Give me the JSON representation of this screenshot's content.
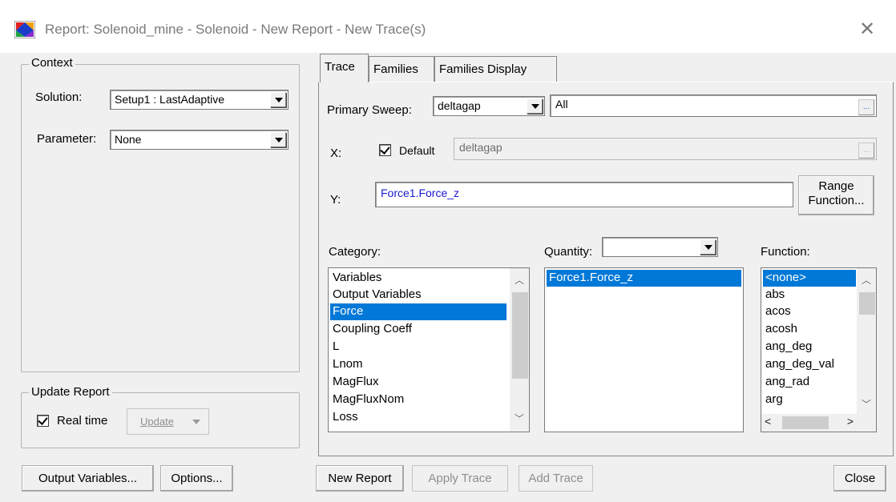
{
  "window": {
    "title": "Report: Solenoid_mine - Solenoid - New Report - New Trace(s)",
    "close_glyph": "✕"
  },
  "context": {
    "group_label": "Context",
    "solution_label": "Solution:",
    "solution_value": "Setup1 : LastAdaptive",
    "parameter_label": "Parameter:",
    "parameter_value": "None"
  },
  "update_report": {
    "group_label": "Update Report",
    "realtime_label": "Real time",
    "realtime_checked": true,
    "update_button": "Update"
  },
  "tabs": [
    {
      "label": "Trace",
      "active": true
    },
    {
      "label": "Families",
      "active": false
    },
    {
      "label": "Families Display",
      "active": false
    }
  ],
  "trace": {
    "primary_sweep_label": "Primary Sweep:",
    "primary_sweep_value": "deltagap",
    "primary_sweep_range": "All",
    "ellipsis": "...",
    "x_label": "X:",
    "x_default_label": "Default",
    "x_default_checked": true,
    "x_value": "deltagap",
    "y_label": "Y:",
    "y_value": "Force1.Force_z",
    "range_function_line1": "Range",
    "range_function_line2": "Function...",
    "category_label": "Category:",
    "quantity_label": "Quantity:",
    "quantity_value": "",
    "function_label": "Function:",
    "category_items": [
      "Variables",
      "Output Variables",
      "Force",
      "Coupling Coeff",
      "L",
      "Lnom",
      "MagFlux",
      "MagFluxNom",
      "Loss"
    ],
    "category_selected": "Force",
    "quantity_items": [
      "Force1.Force_z"
    ],
    "quantity_selected": "Force1.Force_z",
    "function_items": [
      "<none>",
      "abs",
      "acos",
      "acosh",
      "ang_deg",
      "ang_deg_val",
      "ang_rad",
      "arg"
    ],
    "function_selected": "<none>"
  },
  "buttons": {
    "output_variables": "Output Variables...",
    "options": "Options...",
    "new_report": "New Report",
    "apply_trace": "Apply Trace",
    "add_trace": "Add Trace",
    "close": "Close"
  },
  "colors": {
    "selection": "#0078d7",
    "y_text": "#1a1ad0"
  }
}
